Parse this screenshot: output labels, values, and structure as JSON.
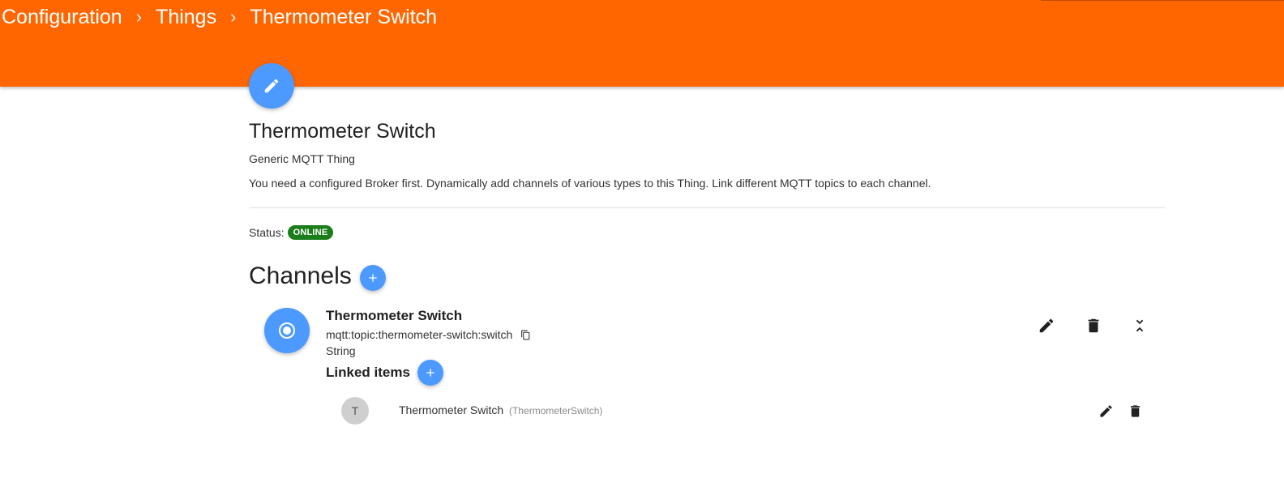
{
  "breadcrumb": {
    "items": [
      "Configuration",
      "Things",
      "Thermometer Switch"
    ],
    "separator": "›"
  },
  "thing": {
    "title": "Thermometer Switch",
    "type": "Generic MQTT Thing",
    "description": "You need a configured Broker first. Dynamically add channels of various types to this Thing. Link different MQTT topics to each channel.",
    "status_label": "Status:",
    "status": "ONLINE"
  },
  "channels": {
    "title": "Channels",
    "list": [
      {
        "name": "Thermometer Switch",
        "uid": "mqtt:topic:thermometer-switch:switch",
        "kind": "String",
        "linked_title": "Linked items",
        "linked_items": [
          {
            "avatar": "T",
            "label": "Thermometer Switch",
            "name": "(ThermometerSwitch)"
          }
        ]
      }
    ]
  },
  "colors": {
    "header": "#ff6600",
    "fab": "#4c9aff",
    "status_online": "#1a7f1a"
  },
  "icons": [
    "pencil-icon",
    "plus-icon",
    "radio-button-icon",
    "copy-icon",
    "trash-icon",
    "collapse-icon"
  ]
}
